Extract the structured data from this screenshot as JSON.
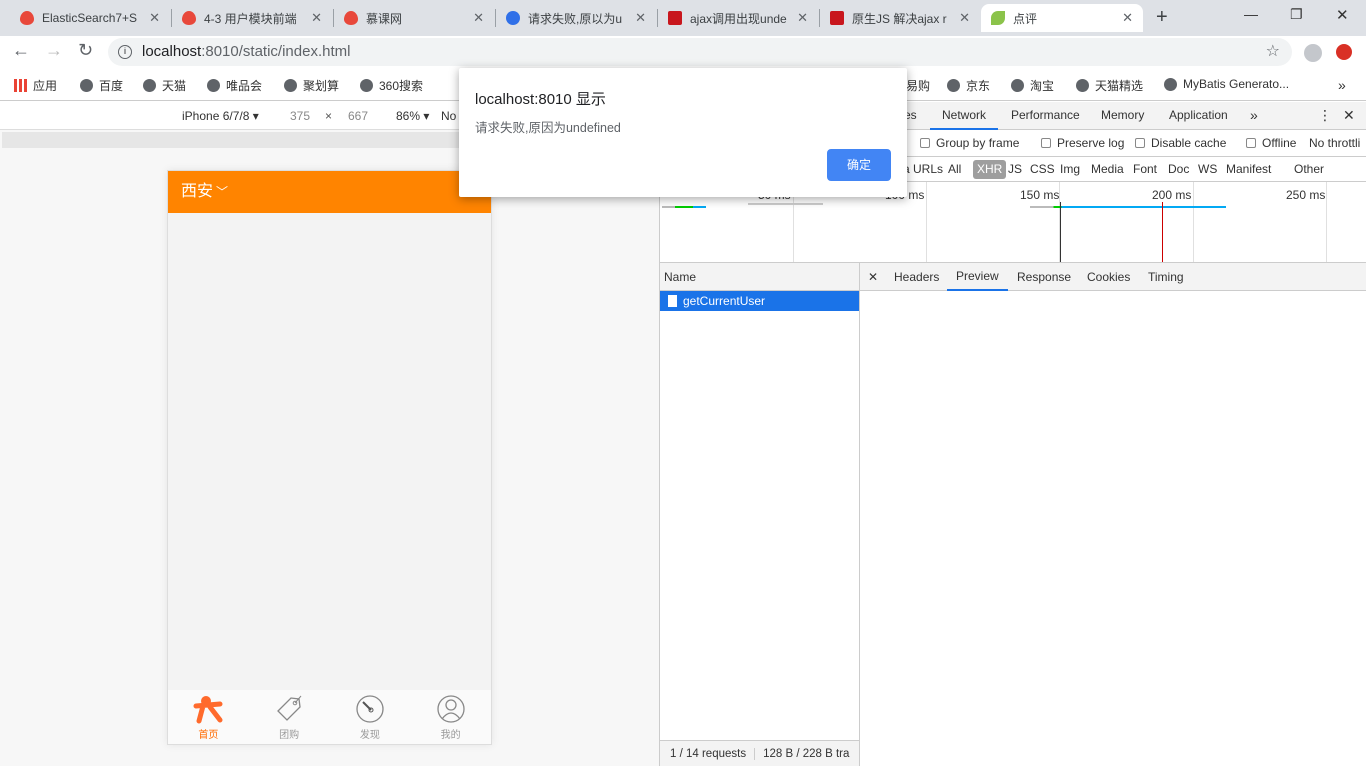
{
  "browser": {
    "tabs": [
      {
        "title": "ElasticSearch7+S",
        "icon": "flame-icon"
      },
      {
        "title": "4-3 用户模块前端",
        "icon": "flame-icon"
      },
      {
        "title": "慕课网",
        "icon": "flame-icon"
      },
      {
        "title": "请求失败,原以为u",
        "icon": "baidu-paw-icon"
      },
      {
        "title": "ajax调用出现unde",
        "icon": "csdn-icon"
      },
      {
        "title": "原生JS 解决ajax r",
        "icon": "csdn-icon"
      },
      {
        "title": "点评",
        "icon": "leaf-icon",
        "active": true
      }
    ],
    "url_host": "localhost",
    "url_rest": ":8010/static/index.html",
    "bookmarks": [
      "应用",
      "百度",
      "天猫",
      "唯品会",
      "聚划算",
      "360搜索",
      "易购",
      "京东",
      "淘宝",
      "天猫精选",
      "MyBatis Generato..."
    ]
  },
  "device_toolbar": {
    "device": "iPhone 6/7/8",
    "width": "375",
    "x": "×",
    "height": "667",
    "zoom": "86%",
    "throttle": "No"
  },
  "phone": {
    "city": "西安",
    "nav": [
      {
        "label": "首页",
        "active": true
      },
      {
        "label": "团购"
      },
      {
        "label": "发现"
      },
      {
        "label": "我的"
      }
    ],
    "accent": "#ff8400"
  },
  "dialog": {
    "title": "localhost:8010 显示",
    "message": "请求失败,原因为undefined",
    "ok": "确定"
  },
  "devtools": {
    "tabs": [
      "es",
      "Network",
      "Performance",
      "Memory",
      "Application"
    ],
    "active_tab": "Network",
    "options": [
      "Group by frame",
      "Preserve log",
      "Disable cache",
      "Offline",
      "No throttli"
    ],
    "filters": [
      "a URLs",
      "All",
      "XHR",
      "JS",
      "CSS",
      "Img",
      "Media",
      "Font",
      "Doc",
      "WS",
      "Manifest",
      "Other"
    ],
    "active_filter": "XHR",
    "timeline_ticks": [
      "50 ms",
      "100 ms",
      "150 ms",
      "200 ms",
      "250 ms"
    ],
    "name_header": "Name",
    "detail_tabs": [
      "Headers",
      "Preview",
      "Response",
      "Cookies",
      "Timing"
    ],
    "active_detail": "Preview",
    "requests": [
      "getCurrentUser"
    ],
    "status": [
      "1 / 14 requests",
      "128 B / 228 B tra"
    ]
  }
}
